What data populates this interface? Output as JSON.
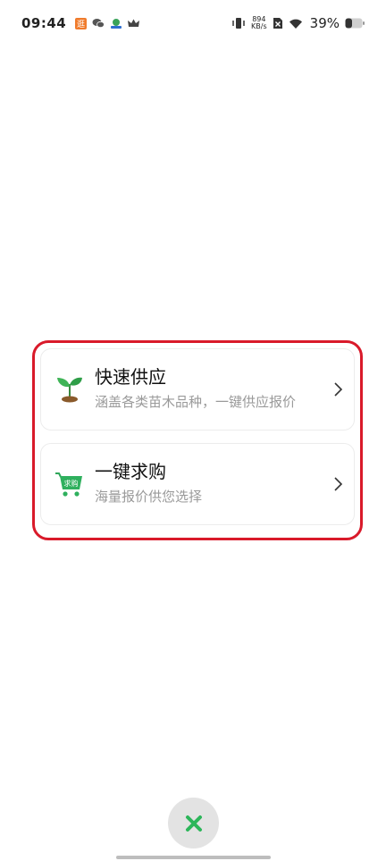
{
  "status_bar": {
    "time": "09:44",
    "speed_value": "894",
    "speed_unit": "KB/s",
    "battery": "39%"
  },
  "actions": [
    {
      "title": "快速供应",
      "subtitle": "涵盖各类苗木品种，一键供应报价",
      "icon": "seedling-icon"
    },
    {
      "title": "一键求购",
      "subtitle": "海量报价供您选择",
      "icon": "cart-icon",
      "icon_badge_text": "求购"
    }
  ],
  "colors": {
    "accent_green": "#2fb05e",
    "highlight_red": "#d91a2a",
    "close_green": "#2cb65a"
  }
}
